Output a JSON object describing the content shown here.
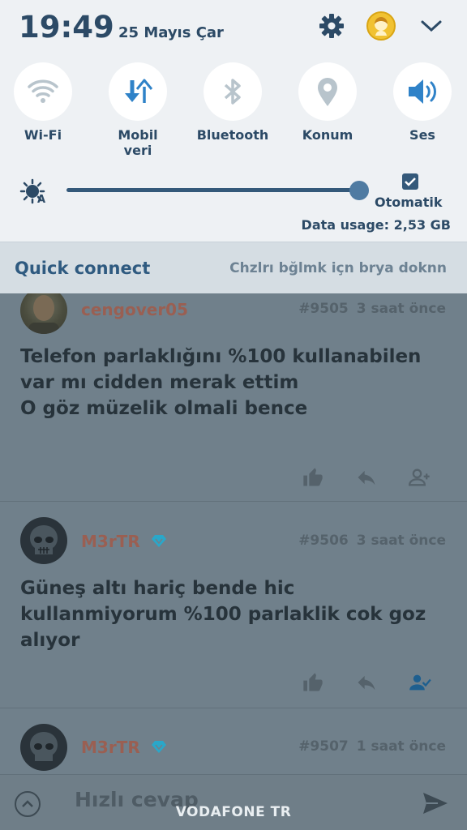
{
  "status": {
    "time": "19:49",
    "date": "25 Mayıs Çar"
  },
  "quick_tiles": [
    {
      "icon": "wifi-icon",
      "label": "Wi-Fi"
    },
    {
      "icon": "mobile-data-icon",
      "label": "Mobil\nveri"
    },
    {
      "icon": "bluetooth-icon",
      "label": "Bluetooth"
    },
    {
      "icon": "location-icon",
      "label": "Konum"
    },
    {
      "icon": "sound-icon",
      "label": "Ses"
    }
  ],
  "brightness": {
    "level": 1.0,
    "auto_label": "Otomatik",
    "auto_checked": true
  },
  "data_usage": "Data usage: 2,53 GB",
  "quick_connect": {
    "title": "Quick connect",
    "hint": "Chzlrı bğlmk içn brya doknn"
  },
  "posts": [
    {
      "username": "cengover05",
      "number": "#9505",
      "time": "3 saat önce",
      "body": "Telefon parlaklığını %100 kullanabilen var mı cidden merak ettim\nO göz müzelik olmali bence"
    },
    {
      "username": "M3rTR",
      "number": "#9506",
      "time": "3 saat önce",
      "body": "Güneş altı hariç bende hic kullanmiyorum %100 parlaklik cok goz alıyor"
    },
    {
      "username": "M3rTR",
      "number": "#9507",
      "time": "1 saat önce",
      "body": ""
    }
  ],
  "reply": {
    "placeholder": "Hızlı cevap"
  },
  "carrier": "VODAFONE TR",
  "colors": {
    "shade_bg": "#eef1f4",
    "accent": "#2c4a66",
    "icon_blue": "#2f82c8",
    "username": "#9a5f52",
    "verified": "#2aa7c9"
  }
}
